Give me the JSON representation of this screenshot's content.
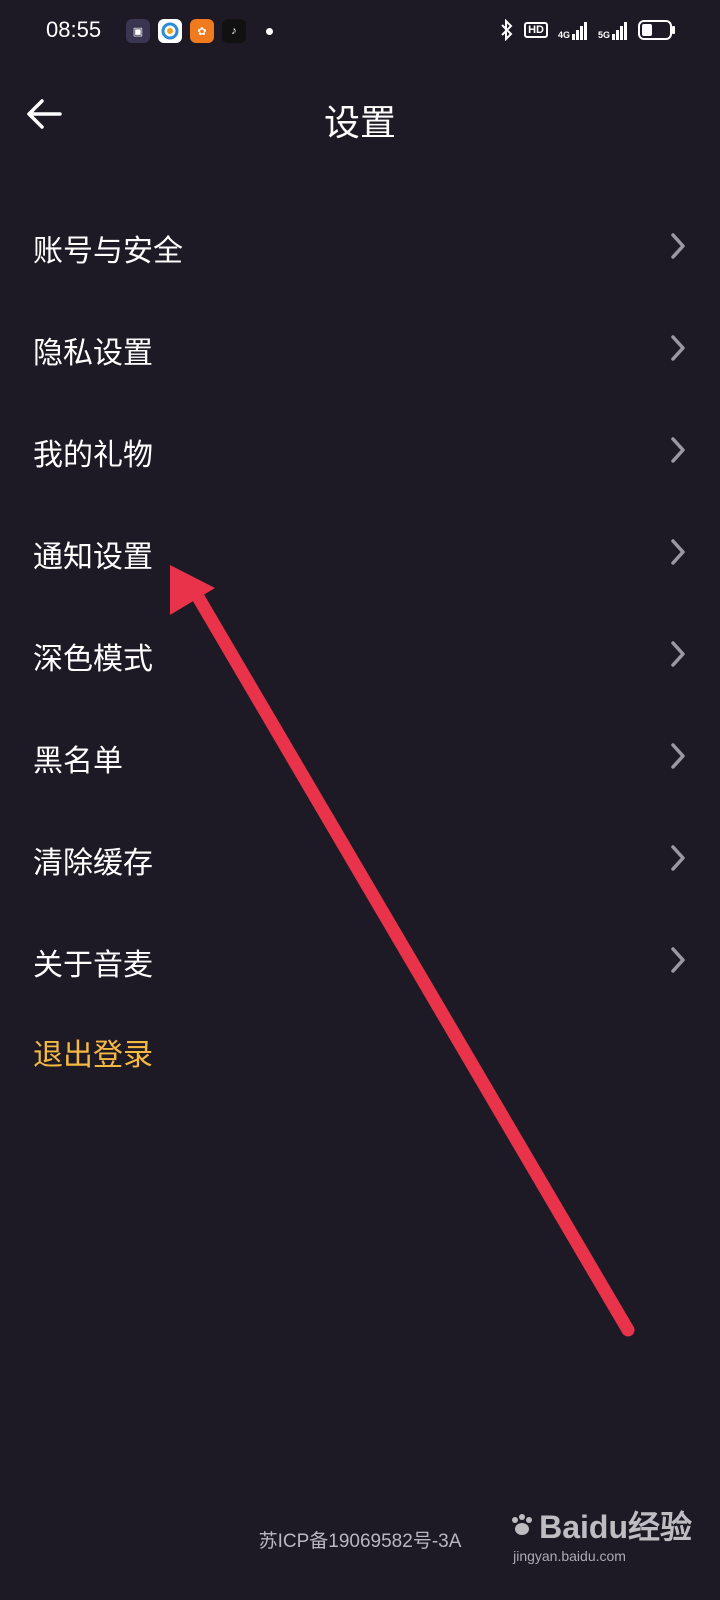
{
  "status_bar": {
    "time": "08:55",
    "notification_apps": [
      "app-icon-1",
      "app-icon-2",
      "app-icon-3",
      "tiktok-icon"
    ],
    "system_icons": [
      "bluetooth-icon",
      "hd-icon",
      "signal-4g-icon",
      "signal-5g-icon",
      "battery-icon"
    ],
    "hd_label": "HD",
    "net1_label": "4G",
    "net2_label": "5G"
  },
  "header": {
    "title": "设置"
  },
  "menu": {
    "items": [
      {
        "label": "账号与安全"
      },
      {
        "label": "隐私设置"
      },
      {
        "label": "我的礼物"
      },
      {
        "label": "通知设置"
      },
      {
        "label": "深色模式"
      },
      {
        "label": "黑名单"
      },
      {
        "label": "清除缓存"
      },
      {
        "label": "关于音麦"
      }
    ],
    "logout_label": "退出登录"
  },
  "footer": {
    "icp": "苏ICP备19069582号-3A"
  },
  "watermark": {
    "logo_text": "Baidu经验",
    "url": "jingyan.baidu.com"
  },
  "colors": {
    "background": "#1d1925",
    "logout": "#f5b942",
    "annotation_arrow": "#e8334a"
  }
}
